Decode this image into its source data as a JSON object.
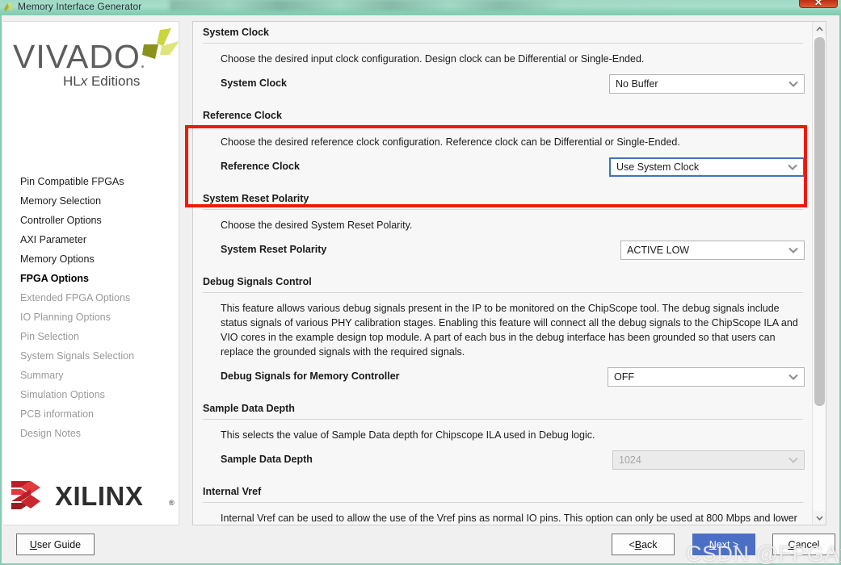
{
  "window": {
    "title": "Memory Interface Generator",
    "close_label": "✕",
    "icon": "vivado-app-icon"
  },
  "sidebar": {
    "brand": {
      "name": "VIVADO",
      "edition": "HL",
      "edition_italic": "x",
      "edition_suffix": " Editions"
    },
    "items": [
      {
        "label": "Pin Compatible FPGAs",
        "state": "enabled"
      },
      {
        "label": "Memory Selection",
        "state": "enabled"
      },
      {
        "label": "Controller Options",
        "state": "enabled"
      },
      {
        "label": "AXI Parameter",
        "state": "enabled"
      },
      {
        "label": "Memory Options",
        "state": "enabled"
      },
      {
        "label": "FPGA Options",
        "state": "active"
      },
      {
        "label": "Extended FPGA Options",
        "state": "disabled"
      },
      {
        "label": "IO Planning Options",
        "state": "disabled"
      },
      {
        "label": "Pin Selection",
        "state": "disabled"
      },
      {
        "label": "System Signals Selection",
        "state": "disabled"
      },
      {
        "label": "Summary",
        "state": "disabled"
      },
      {
        "label": "Simulation Options",
        "state": "disabled"
      },
      {
        "label": "PCB information",
        "state": "disabled"
      },
      {
        "label": "Design Notes",
        "state": "disabled"
      }
    ],
    "vendor": {
      "name": "XILINX",
      "registered": "®"
    }
  },
  "sections": [
    {
      "id": "system-clock",
      "title": "System Clock",
      "description": "Choose the desired input clock configuration. Design clock can be Differential or Single-Ended.",
      "field_label": "System Clock",
      "field_value": "No Buffer",
      "field_state": "normal"
    },
    {
      "id": "reference-clock",
      "title": "Reference Clock",
      "description": "Choose the desired reference clock configuration. Reference clock can be Differential or Single-Ended.",
      "field_label": "Reference Clock",
      "field_value": "Use System Clock",
      "field_state": "focused"
    },
    {
      "id": "system-reset-polarity",
      "title": "System Reset Polarity",
      "description": "Choose the desired System Reset Polarity.",
      "field_label": "System Reset Polarity",
      "field_value": "ACTIVE LOW",
      "field_state": "normal"
    },
    {
      "id": "debug-signals-control",
      "title": "Debug Signals Control",
      "description": "This feature allows various debug signals present in the IP to be monitored on the ChipScope tool. The debug signals include status signals of various PHY calibration stages. Enabling this feature will connect all the debug signals to the ChipScope ILA and VIO cores in the example design top module. A part of each bus in the debug interface has been grounded so that users can replace the grounded signals with the required signals.",
      "field_label": "Debug Signals for Memory Controller",
      "field_value": "OFF",
      "field_state": "normal"
    },
    {
      "id": "sample-data-depth",
      "title": "Sample Data Depth",
      "description": "This selects the value of Sample Data depth for Chipscope ILA used in Debug logic.",
      "field_label": "Sample Data Depth",
      "field_value": "1024",
      "field_state": "disabled"
    },
    {
      "id": "internal-vref",
      "title": "Internal Vref",
      "description": "Internal Vref can be used to allow the use of the Vref pins as normal IO pins. This option can only be used at 800 Mbps and lower",
      "field_label": "",
      "field_value": "",
      "field_state": "none"
    }
  ],
  "annotation": {
    "target_section": "reference-clock",
    "color": "#f01a00"
  },
  "footer": {
    "user_guide": {
      "mnemonic": "U",
      "rest": "ser Guide"
    },
    "back": {
      "prefix": "< ",
      "mnemonic": "B",
      "rest": "ack"
    },
    "next": {
      "prefix": "",
      "mnemonic": "N",
      "rest": "ext >"
    },
    "cancel": {
      "prefix": "",
      "mnemonic": "C",
      "rest": "ancel"
    }
  },
  "watermark": {
    "text": "CSDN @FPGA大叔"
  },
  "scrollbar": {
    "up": "chevron-up-icon",
    "down": "chevron-down-icon"
  },
  "colors": {
    "accent_blue": "#4a6fc4",
    "focus_blue": "#3d74bf",
    "annotation_red": "#f01a00",
    "titlebar_green": "#9fd9c4",
    "xilinx_red": "#c8202a"
  }
}
